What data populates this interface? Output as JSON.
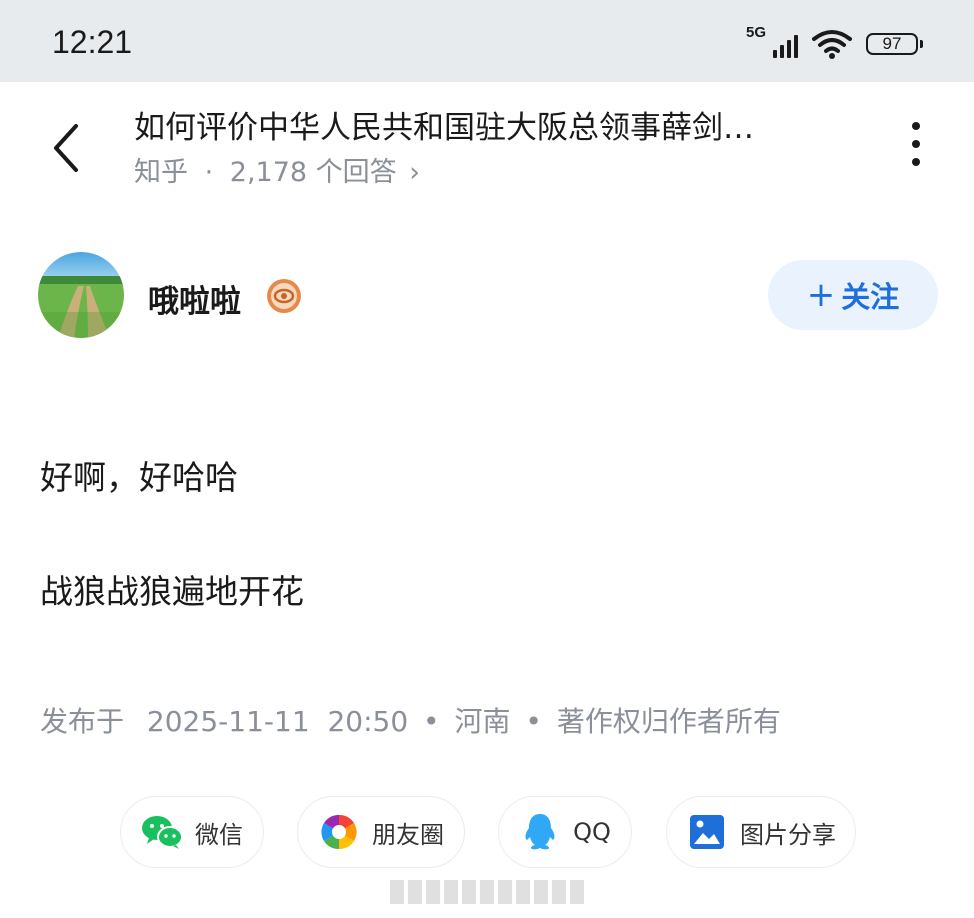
{
  "status_bar": {
    "time": "12:21",
    "network": "5G",
    "battery": "97"
  },
  "header": {
    "title": "如何评价中华人民共和国驻大阪总领事薛剑…",
    "source": "知乎",
    "separator": "·",
    "answers_count": "2,178 个回答",
    "chevron": "›"
  },
  "author": {
    "name": "哦啦啦",
    "follow_plus": "+",
    "follow_label": "关注"
  },
  "answer": {
    "paragraphs": [
      "好啊，好哈哈",
      "战狼战狼遍地开花"
    ]
  },
  "meta": {
    "published_label": "发布于",
    "datetime": "2025-11-11  20:50",
    "dot": "•",
    "location": "河南",
    "copyright": "著作权归作者所有"
  },
  "share": {
    "wechat": "微信",
    "moments": "朋友圈",
    "qq": "QQ",
    "image_share": "图片分享"
  },
  "colors": {
    "accent": "#1e6fd9",
    "follow_bg": "#e9f2fd",
    "muted_text": "#8a8f99",
    "status_bar_bg": "#e8ebee"
  }
}
